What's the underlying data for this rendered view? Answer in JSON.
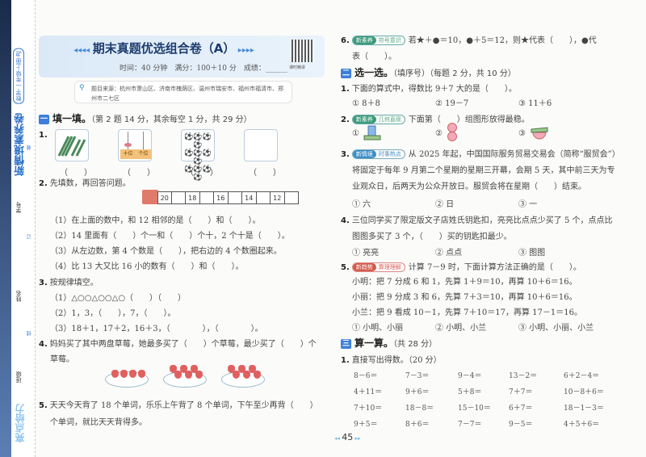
{
  "sidebar": {
    "series": "新情境素养卷",
    "subject": "数学·一年级·上册·RJ",
    "student_id": "学号",
    "name": "姓名",
    "class": "班级",
    "brand": "亮点给力",
    "binding": [
      "装",
      "订",
      "线"
    ]
  },
  "header": {
    "title": "期末真题优选组合卷（A）",
    "time": "时间：40 分钟",
    "full_score": "满分：100＋10 分",
    "score": "成绩：",
    "qr_label": "课时精讲"
  },
  "source": "题目来源：杭州市萧山区、济南市槐荫区、温州市瑞安市、福州市福清市、郑州市二七区",
  "section1": {
    "num": "一",
    "title": "填一填。",
    "note": "（第 2 题 14 分，其余每空 1 分，共 29 分）",
    "q1": {
      "num": "1.",
      "abacus_labels": [
        "十位",
        "个位"
      ],
      "blank": "（　　）"
    },
    "q2": {
      "num": "2.",
      "text": "先填数，再回答问题。",
      "train": [
        "20",
        "",
        "18",
        "",
        "16",
        "",
        "14",
        "",
        "12",
        ""
      ],
      "subs": [
        "（1）在上面的数中，和 12 相邻的是（　　）和（　　）。",
        "（2）14 里面有（　　）个一和（　　）个十，2 个十是（　　）。",
        "（3）从左边数，第 4 个数是（　　），把右边的 4 个数圈起来。",
        "（4）比 13 大又比 16 小的数有（　　）和（　　）。"
      ]
    },
    "q3": {
      "num": "3.",
      "text": "按规律填空。",
      "subs": [
        "（1）△○○△○○△○（　　）（　　）",
        "（2）1，3，（　　），7，（　　）。",
        "（3）18＋1，17＋2，16＋3，（　　　　），（　　　　）。"
      ]
    },
    "q4": {
      "num": "4.",
      "line1": "妈妈买了其中两盘草莓，她最多买了（　　）个草莓，最少买了（　　）个",
      "line2": "草莓。",
      "plates": [
        4,
        6,
        6
      ]
    },
    "q5": {
      "num": "5.",
      "line1": "天天今天背了 18 个单词，乐乐上午背了 8 个单词，下午至少再背（　　）",
      "line2": "个单词，就比天天背得多。"
    },
    "q6": {
      "num": "6.",
      "tag": [
        "新素养",
        "符号意识"
      ],
      "line1": "若★＋●＝10，●＋5＝12，则★代表（　　），●代",
      "line2": "表（　　）。"
    }
  },
  "section2": {
    "num": "二",
    "title": "选一选。",
    "note": "（填序号）（每题 2 分，共 10 分）",
    "q1": {
      "num": "1.",
      "text": "下面的算式中，得数比 9＋7 大的是（　　）。",
      "options": [
        "① 8＋8",
        "② 19－7",
        "③ 11＋6"
      ]
    },
    "q2": {
      "num": "2.",
      "tag": [
        "新素养",
        "几何直观"
      ],
      "text": "下面第（　　）组图形放得最稳。",
      "options": [
        "①",
        "②",
        "③"
      ]
    },
    "q3": {
      "num": "3.",
      "tag": [
        "新情境",
        "时事热点"
      ],
      "lines": [
        "从 2025 年起，中国国际服务贸易交易会（简称“服贸会”）",
        "将固定于每年 9 月第二个星期的星期三开幕，会期 5 天，其中前三天为专",
        "业观众日，后两天为公众开放日。服贸会将在星期（　　）结束。"
      ],
      "options": [
        "① 六",
        "② 日",
        "③ 一"
      ]
    },
    "q4": {
      "num": "4.",
      "lines": [
        "三位同学买了限定版文子店姓氏钥匙扣，亮亮比点点少买了 5 个，点点比",
        "图图多买了 3 个，（　　）买的钥匙扣最少。"
      ],
      "options": [
        "① 亮亮",
        "② 点点",
        "③ 图图"
      ]
    },
    "q5": {
      "num": "5.",
      "tag": [
        "新趋势",
        "算理理解"
      ],
      "text": "计算 7－9 时，下面计算方法正确的是（　　）。",
      "lines": [
        "小明：把 7 分成 6 和 1，先算 1＋9＝10，再算 10＋6＝16。",
        "小丽：把 9 分成 3 和 6，先算 7＋3＝10，再算 10＋6＝16。",
        "小兰：把 9 看成 10－1，先算 7＋10＝17，再算 17－1＝16。"
      ],
      "options": [
        "① 小明、小丽",
        "② 小明、小兰",
        "③ 小明、小丽、小兰"
      ]
    }
  },
  "section3": {
    "num": "三",
    "title": "算一算。",
    "note": "（共 28 分）",
    "q1": {
      "num": "1.",
      "text": "直接写出得数。（20 分）",
      "rows": [
        [
          "8－6＝",
          "7－3＝",
          "9－4＝",
          "13－2＝",
          "6＋2－4＝"
        ],
        [
          "4＋11＝",
          "9＋6＝",
          "5＋8＝",
          "7＋7＝",
          "10－8＋6＝"
        ],
        [
          "7＋10＝",
          "18－8＝",
          "15－10＝",
          "6＋7＝",
          "18－1－3＝"
        ],
        [
          "9＋5＝",
          "8＋6＝",
          "7－7＝",
          "9－5＝",
          "4＋5＋6＝"
        ]
      ]
    }
  },
  "page_number": "45"
}
